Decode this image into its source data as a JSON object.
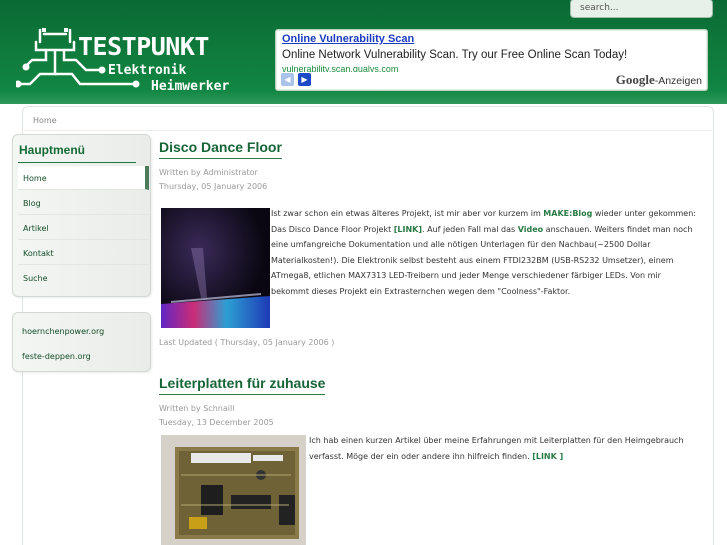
{
  "search": {
    "placeholder": "search..."
  },
  "logo": {
    "title": "TESTPUNKT",
    "subtitle_1": "Elektronik",
    "subtitle_2": "Heimwerker"
  },
  "ad": {
    "title": "Online Vulnerability Scan",
    "text": "Online Network Vulnerability Scan. Try our Free Online Scan Today!",
    "url": "vulnerability.scan.qualys.com",
    "google": "Google",
    "anzeigen": "-Anzeigen"
  },
  "breadcrumb": "Home",
  "sidebar": {
    "menu_title": "Hauptmenü",
    "items": [
      {
        "label": "Home"
      },
      {
        "label": "Blog"
      },
      {
        "label": "Artikel"
      },
      {
        "label": "Kontakt"
      },
      {
        "label": "Suche"
      }
    ],
    "links": [
      {
        "label": "hoernchenpower.org"
      },
      {
        "label": "feste-deppen.org"
      }
    ]
  },
  "articles": [
    {
      "title": "Disco Dance Floor",
      "author": "Written by Administrator",
      "date": "Thursday, 05 January 2006",
      "body": {
        "t1": "Ist zwar schon ein etwas älteres Projekt, ist mir aber vor kurzem im ",
        "l1": "MAKE:Blog",
        "t2": " wieder unter gekommen: Das Disco Dance Floor Projekt ",
        "l2": "[LINK]",
        "t3": ". Auf jeden Fall mal das ",
        "l3": "Video",
        "t4": " anschauen. Weiters findet man noch eine umfangreiche Dokumentation und alle nötigen Unterlagen für den Nachbau(~2500 Dollar Materialkosten!). Die Elektronik selbst besteht aus einem FTDI232BM (USB-RS232 Umsetzer), einem ATmega8, etlichen MAX7313 LED-Treibern und jeder Menge verschiedener färbiger LEDs. Von mir bekommt dieses Projekt ein Extrasternchen wegen dem \"Coolness\"-Faktor."
      },
      "updated": "Last Updated ( Thursday, 05 January 2006 )"
    },
    {
      "title": "Leiterplatten für zuhause",
      "author": "Written by Schnaill",
      "date": "Tuesday, 13 December 2005",
      "body": {
        "t1": "Ich hab einen kurzen Artikel über meine Erfahrungen mit Leiterplatten für den Heimgebrauch verfasst. Möge der ein oder andere ihn hilfreich finden. ",
        "l1": "[LINK ]"
      }
    }
  ]
}
